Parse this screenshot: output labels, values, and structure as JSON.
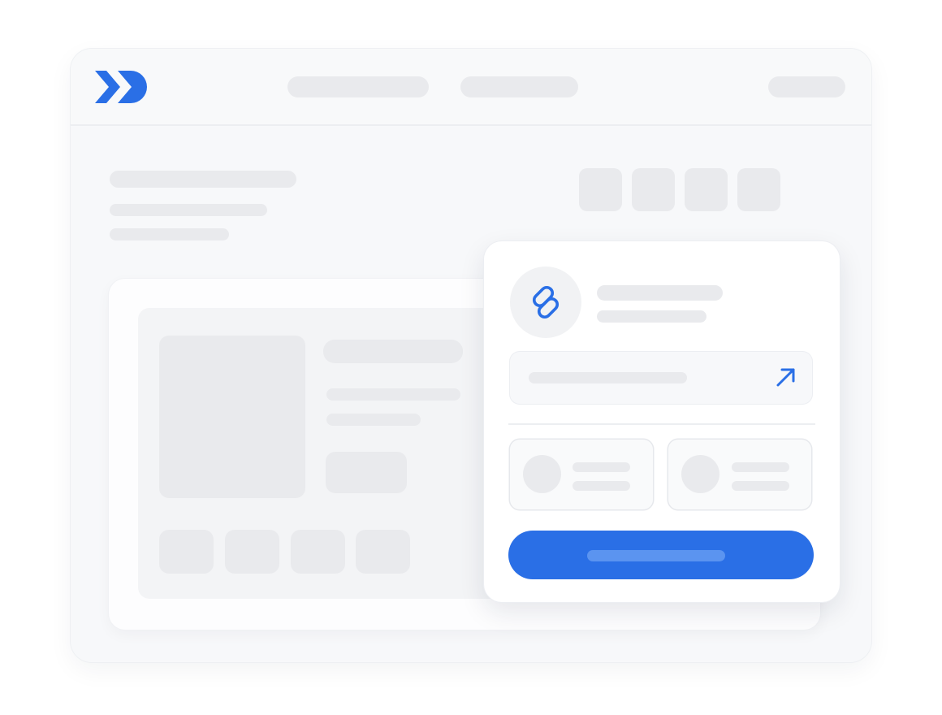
{
  "colors": {
    "brand": "#2a6fe6",
    "placeholder_bar": "#e9eaed",
    "window_background": "#f7f8fa",
    "card_background": "#ffffff"
  },
  "header": {
    "logo_icon": "double-chevron-logo",
    "nav_items": [
      {
        "label": "",
        "icon": ""
      },
      {
        "label": "",
        "icon": ""
      }
    ],
    "account_label": ""
  },
  "page": {
    "title": "",
    "subtitle_lines": [
      "",
      ""
    ],
    "toolbar_tiles": 4
  },
  "content_card": {
    "heading": "",
    "text_lines": [
      "",
      ""
    ],
    "button_label": "",
    "thumbnails": 4
  },
  "share_popover": {
    "icon": "link-icon",
    "title": "",
    "subtitle": "",
    "url_value": "",
    "open_icon": "arrow-up-right-icon",
    "options": [
      {
        "label": "",
        "sublabel": ""
      },
      {
        "label": "",
        "sublabel": ""
      }
    ],
    "primary_button_label": ""
  }
}
